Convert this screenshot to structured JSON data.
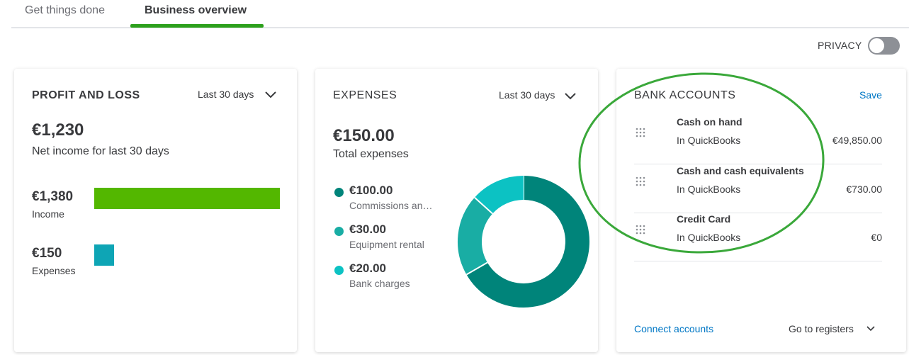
{
  "tabs": [
    {
      "label": "Get things done"
    },
    {
      "label": "Business overview"
    }
  ],
  "privacy": {
    "label": "PRIVACY",
    "enabled": false
  },
  "profit_loss": {
    "title": "PROFIT AND LOSS",
    "range": "Last 30 days",
    "amount": "€1,230",
    "subtitle": "Net income for last 30 days",
    "income": {
      "value": "€1,380",
      "label": "Income",
      "amount": 1380
    },
    "expenses": {
      "value": "€150",
      "label": "Expenses",
      "amount": 150
    }
  },
  "expenses": {
    "title": "EXPENSES",
    "range": "Last 30 days",
    "amount": "€150.00",
    "subtitle": "Total expenses",
    "items": [
      {
        "value": "€100.00",
        "label": "Commissions an…",
        "amount": 100,
        "color": "#00847a"
      },
      {
        "value": "€30.00",
        "label": "Equipment rental",
        "amount": 30,
        "color": "#19ada4"
      },
      {
        "value": "€20.00",
        "label": "Bank charges",
        "amount": 20,
        "color": "#0cc2c3"
      }
    ]
  },
  "bank": {
    "title": "BANK ACCOUNTS",
    "save_label": "Save",
    "accounts": [
      {
        "name": "Cash on hand",
        "source": "In QuickBooks",
        "balance": "€49,850.00"
      },
      {
        "name": "Cash and cash equivalents",
        "source": "In QuickBooks",
        "balance": "€730.00"
      },
      {
        "name": "Credit Card",
        "source": "In QuickBooks",
        "balance": "€0"
      }
    ],
    "connect_label": "Connect accounts",
    "registers_label": "Go to registers"
  },
  "colors": {
    "accent_green": "#2ca01c",
    "income_bar": "#53b700",
    "expense_bar": "#0ea5b5",
    "link_blue": "#0077c5",
    "annotation": "#3aa83a"
  }
}
